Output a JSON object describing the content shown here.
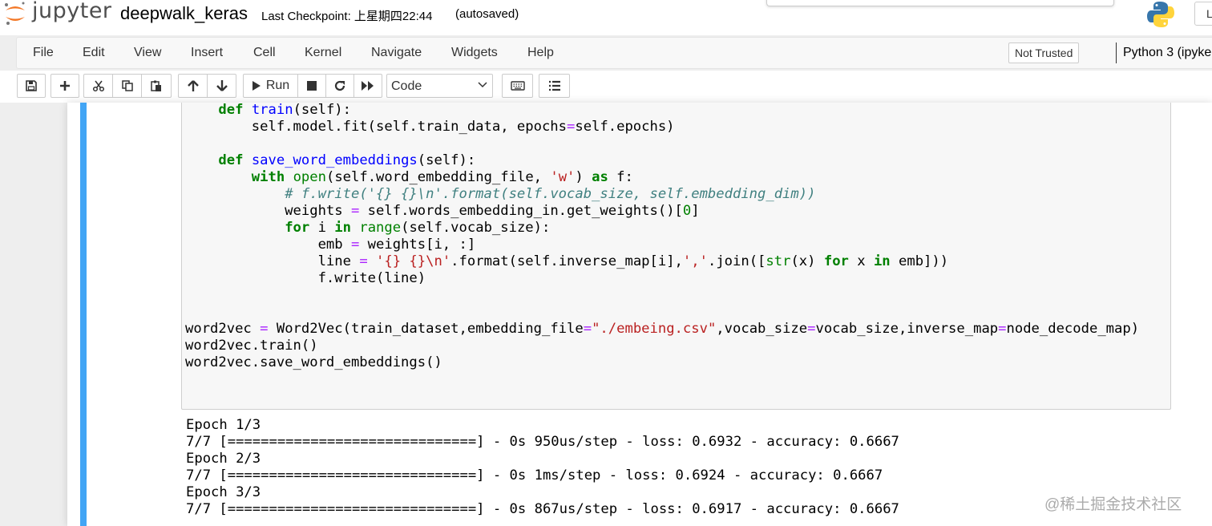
{
  "header": {
    "logo_text": "jupyter",
    "notebook_name": "deepwalk_keras",
    "checkpoint_text": "Last Checkpoint: 上星期四22:44",
    "autosave_status": "(autosaved)",
    "logout_label": "L"
  },
  "menubar": {
    "items": [
      "File",
      "Edit",
      "View",
      "Insert",
      "Cell",
      "Kernel",
      "Navigate",
      "Widgets",
      "Help"
    ],
    "trust_status": "Not Trusted",
    "kernel_name": "Python 3 (ipyke"
  },
  "toolbar": {
    "run_label": "Run",
    "cell_type": "Code",
    "icons": [
      "save-icon",
      "plus-icon",
      "cut-icon",
      "copy-icon",
      "paste-icon",
      "arrow-up-icon",
      "arrow-down-icon",
      "play-icon",
      "stop-icon",
      "restart-icon",
      "fast-forward-icon",
      "keyboard-icon",
      "list-icon"
    ]
  },
  "cell": {
    "code_lines": [
      "    def train(self):",
      "        self.model.fit(self.train_data, epochs=self.epochs)",
      "",
      "    def save_word_embeddings(self):",
      "        with open(self.word_embedding_file, 'w') as f:",
      "            # f.write('{} {}\\n'.format(self.vocab_size, self.embedding_dim))",
      "            weights = self.words_embedding_in.get_weights()[0]",
      "            for i in range(self.vocab_size):",
      "                emb = weights[i, :]",
      "                line = '{} {}\\n'.format(self.inverse_map[i],','.join([str(x) for x in emb]))",
      "                f.write(line)",
      "",
      "",
      "word2vec = Word2Vec(train_dataset,embedding_file=\"./embeing.csv\",vocab_size=vocab_size,inverse_map=node_decode_map)",
      "word2vec.train()",
      "word2vec.save_word_embeddings()"
    ],
    "output_lines": [
      "Epoch 1/3",
      "7/7 [==============================] - 0s 950us/step - loss: 0.6932 - accuracy: 0.6667",
      "Epoch 2/3",
      "7/7 [==============================] - 0s 1ms/step - loss: 0.6924 - accuracy: 0.6667",
      "Epoch 3/3",
      "7/7 [==============================] - 0s 867us/step - loss: 0.6917 - accuracy: 0.6667"
    ]
  },
  "watermark": "@稀土掘金技术社区",
  "colors": {
    "keyword": "#008000",
    "function_name": "#0000ff",
    "string": "#ba2121",
    "operator": "#aa22ff",
    "comment": "#408080",
    "selected_cell_bar": "#42a5f5",
    "logo_orange": "#f37726"
  }
}
